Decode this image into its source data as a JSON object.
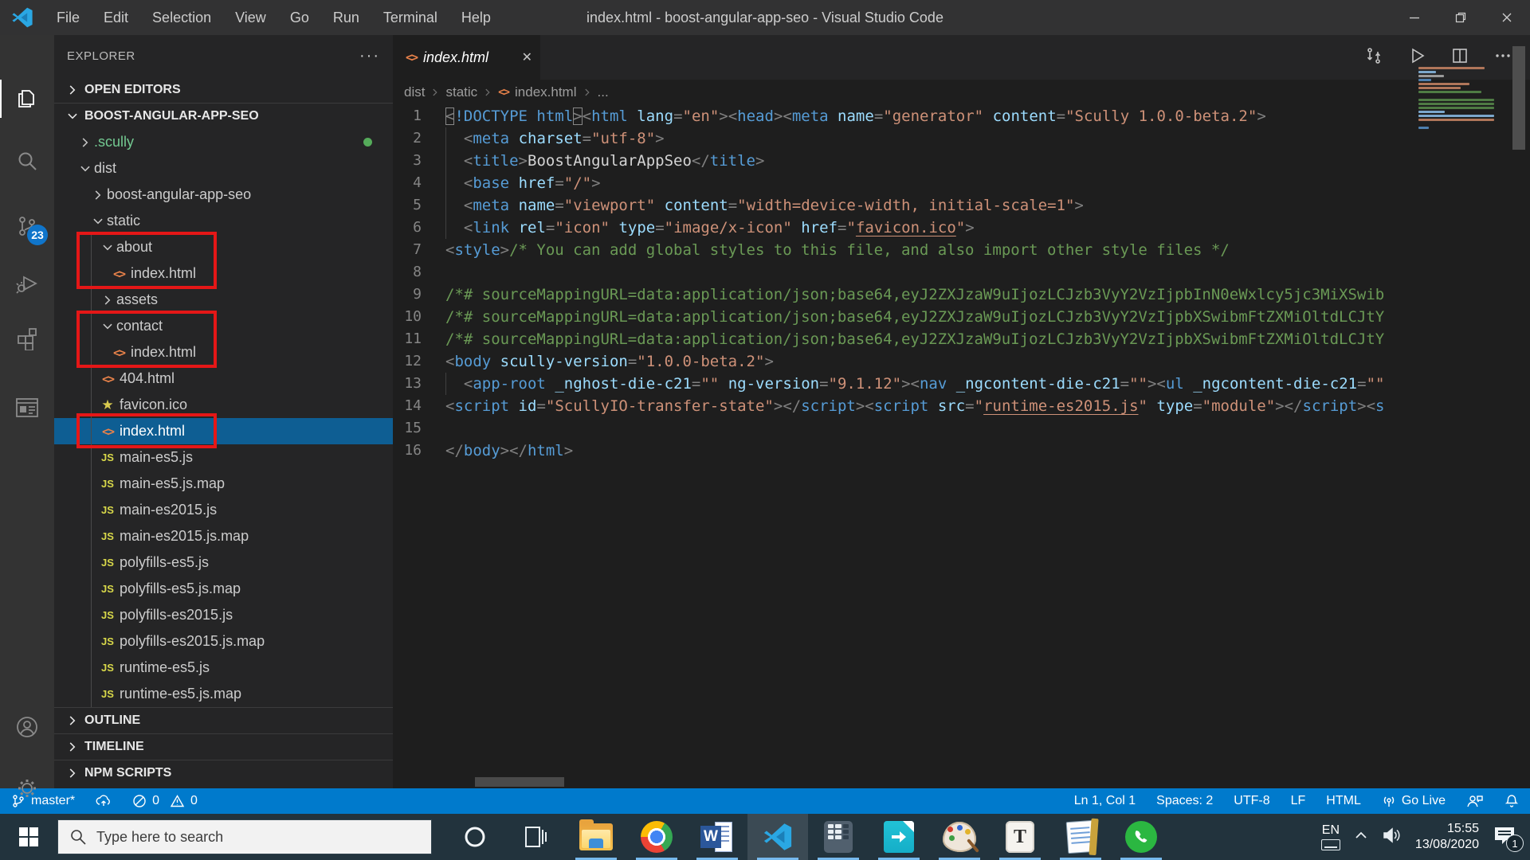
{
  "window": {
    "title": "index.html - boost-angular-app-seo - Visual Studio Code"
  },
  "menu": {
    "items": [
      "File",
      "Edit",
      "Selection",
      "View",
      "Go",
      "Run",
      "Terminal",
      "Help"
    ]
  },
  "activity_bar": {
    "source_control_badge": "23"
  },
  "explorer": {
    "title": "EXPLORER",
    "open_editors": "OPEN EDITORS",
    "project": "BOOST-ANGULAR-APP-SEO",
    "tree": [
      {
        "label": ".scully",
        "kind": "folder",
        "expanded": false,
        "level": 1,
        "green": true,
        "dot": true
      },
      {
        "label": "dist",
        "kind": "folder",
        "expanded": true,
        "level": 1
      },
      {
        "label": "boost-angular-app-seo",
        "kind": "folder",
        "expanded": false,
        "level": 2
      },
      {
        "label": "static",
        "kind": "folder",
        "expanded": true,
        "level": 2
      },
      {
        "label": "about",
        "kind": "folder",
        "expanded": true,
        "level": 3
      },
      {
        "label": "index.html",
        "kind": "html",
        "level": 4
      },
      {
        "label": "assets",
        "kind": "folder",
        "expanded": false,
        "level": 3
      },
      {
        "label": "contact",
        "kind": "folder",
        "expanded": true,
        "level": 3
      },
      {
        "label": "index.html",
        "kind": "html",
        "level": 4
      },
      {
        "label": "404.html",
        "kind": "html",
        "level": 3
      },
      {
        "label": "favicon.ico",
        "kind": "ico",
        "level": 3
      },
      {
        "label": "index.html",
        "kind": "html",
        "level": 3,
        "selected": true
      },
      {
        "label": "main-es5.js",
        "kind": "js",
        "level": 3
      },
      {
        "label": "main-es5.js.map",
        "kind": "js",
        "level": 3
      },
      {
        "label": "main-es2015.js",
        "kind": "js",
        "level": 3
      },
      {
        "label": "main-es2015.js.map",
        "kind": "js",
        "level": 3
      },
      {
        "label": "polyfills-es5.js",
        "kind": "js",
        "level": 3
      },
      {
        "label": "polyfills-es5.js.map",
        "kind": "js",
        "level": 3
      },
      {
        "label": "polyfills-es2015.js",
        "kind": "js",
        "level": 3
      },
      {
        "label": "polyfills-es2015.js.map",
        "kind": "js",
        "level": 3
      },
      {
        "label": "runtime-es5.js",
        "kind": "js",
        "level": 3
      },
      {
        "label": "runtime-es5.js.map",
        "kind": "js",
        "level": 3
      }
    ],
    "sections": [
      "OUTLINE",
      "TIMELINE",
      "NPM SCRIPTS"
    ]
  },
  "editor": {
    "tab": {
      "label": "index.html"
    },
    "breadcrumb": [
      "dist",
      "static",
      "index.html",
      "..."
    ],
    "lines": [
      {
        "seg": [
          [
            "b",
            "<"
          ],
          [
            "t",
            "!DOCTYPE html"
          ],
          [
            "b",
            ">"
          ],
          [
            "p",
            "<"
          ],
          [
            "t",
            "html"
          ],
          [
            "x",
            " "
          ],
          [
            "a",
            "lang"
          ],
          [
            "p",
            "="
          ],
          [
            "v",
            "\"en\""
          ],
          [
            "p",
            "><"
          ],
          [
            "t",
            "head"
          ],
          [
            "p",
            "><"
          ],
          [
            "t",
            "meta"
          ],
          [
            "x",
            " "
          ],
          [
            "a",
            "name"
          ],
          [
            "p",
            "="
          ],
          [
            "v",
            "\"generator\""
          ],
          [
            "x",
            " "
          ],
          [
            "a",
            "content"
          ],
          [
            "p",
            "="
          ],
          [
            "v",
            "\"Scully 1.0.0-beta.2\""
          ],
          [
            "p",
            ">"
          ]
        ]
      },
      {
        "guide": true,
        "seg": [
          [
            "x",
            "  "
          ],
          [
            "p",
            "<"
          ],
          [
            "t",
            "meta"
          ],
          [
            "x",
            " "
          ],
          [
            "a",
            "charset"
          ],
          [
            "p",
            "="
          ],
          [
            "v",
            "\"utf-8\""
          ],
          [
            "p",
            ">"
          ]
        ]
      },
      {
        "guide": true,
        "seg": [
          [
            "x",
            "  "
          ],
          [
            "p",
            "<"
          ],
          [
            "t",
            "title"
          ],
          [
            "p",
            ">"
          ],
          [
            "x",
            "BoostAngularAppSeo"
          ],
          [
            "p",
            "</"
          ],
          [
            "t",
            "title"
          ],
          [
            "p",
            ">"
          ]
        ]
      },
      {
        "guide": true,
        "seg": [
          [
            "x",
            "  "
          ],
          [
            "p",
            "<"
          ],
          [
            "t",
            "base"
          ],
          [
            "x",
            " "
          ],
          [
            "a",
            "href"
          ],
          [
            "p",
            "="
          ],
          [
            "v",
            "\"/\""
          ],
          [
            "p",
            ">"
          ]
        ]
      },
      {
        "guide": true,
        "seg": [
          [
            "x",
            "  "
          ],
          [
            "p",
            "<"
          ],
          [
            "t",
            "meta"
          ],
          [
            "x",
            " "
          ],
          [
            "a",
            "name"
          ],
          [
            "p",
            "="
          ],
          [
            "v",
            "\"viewport\""
          ],
          [
            "x",
            " "
          ],
          [
            "a",
            "content"
          ],
          [
            "p",
            "="
          ],
          [
            "v",
            "\"width=device-width, initial-scale=1\""
          ],
          [
            "p",
            ">"
          ]
        ]
      },
      {
        "guide": true,
        "seg": [
          [
            "x",
            "  "
          ],
          [
            "p",
            "<"
          ],
          [
            "t",
            "link"
          ],
          [
            "x",
            " "
          ],
          [
            "a",
            "rel"
          ],
          [
            "p",
            "="
          ],
          [
            "v",
            "\"icon\""
          ],
          [
            "x",
            " "
          ],
          [
            "a",
            "type"
          ],
          [
            "p",
            "="
          ],
          [
            "v",
            "\"image/x-icon\""
          ],
          [
            "x",
            " "
          ],
          [
            "a",
            "href"
          ],
          [
            "p",
            "="
          ],
          [
            "v",
            "\""
          ],
          [
            "u",
            "favicon.ico"
          ],
          [
            "v",
            "\""
          ],
          [
            "p",
            ">"
          ]
        ]
      },
      {
        "seg": [
          [
            "p",
            "<"
          ],
          [
            "t",
            "style"
          ],
          [
            "p",
            ">"
          ],
          [
            "c",
            "/* You can add global styles to this file, and also import other style files */"
          ]
        ]
      },
      {
        "seg": []
      },
      {
        "seg": [
          [
            "c",
            "/*# sourceMappingURL=data:application/json;base64,eyJ2ZXJzaW9uIjozLCJzb3VyY2VzIjpbInN0eWxlcy5jc3MiXSwib"
          ]
        ]
      },
      {
        "seg": [
          [
            "c",
            "/*# sourceMappingURL=data:application/json;base64,eyJ2ZXJzaW9uIjozLCJzb3VyY2VzIjpbXSwibmFtZXMiOltdLCJtY"
          ]
        ]
      },
      {
        "seg": [
          [
            "c",
            "/*# sourceMappingURL=data:application/json;base64,eyJ2ZXJzaW9uIjozLCJzb3VyY2VzIjpbXSwibmFtZXMiOltdLCJtY"
          ]
        ]
      },
      {
        "seg": [
          [
            "p",
            "<"
          ],
          [
            "t",
            "body"
          ],
          [
            "x",
            " "
          ],
          [
            "a",
            "scully-version"
          ],
          [
            "p",
            "="
          ],
          [
            "v",
            "\"1.0.0-beta.2\""
          ],
          [
            "p",
            ">"
          ]
        ]
      },
      {
        "guide": true,
        "seg": [
          [
            "x",
            "  "
          ],
          [
            "p",
            "<"
          ],
          [
            "t",
            "app-root"
          ],
          [
            "x",
            " "
          ],
          [
            "a",
            "_nghost-die-c21"
          ],
          [
            "p",
            "="
          ],
          [
            "v",
            "\"\""
          ],
          [
            "x",
            " "
          ],
          [
            "a",
            "ng-version"
          ],
          [
            "p",
            "="
          ],
          [
            "v",
            "\"9.1.12\""
          ],
          [
            "p",
            "><"
          ],
          [
            "t",
            "nav"
          ],
          [
            "x",
            " "
          ],
          [
            "a",
            "_ngcontent-die-c21"
          ],
          [
            "p",
            "="
          ],
          [
            "v",
            "\"\""
          ],
          [
            "p",
            "><"
          ],
          [
            "t",
            "ul"
          ],
          [
            "x",
            " "
          ],
          [
            "a",
            "_ngcontent-die-c21"
          ],
          [
            "p",
            "="
          ],
          [
            "v",
            "\"\""
          ]
        ]
      },
      {
        "seg": [
          [
            "p",
            "<"
          ],
          [
            "t",
            "script"
          ],
          [
            "x",
            " "
          ],
          [
            "a",
            "id"
          ],
          [
            "p",
            "="
          ],
          [
            "v",
            "\"ScullyIO-transfer-state\""
          ],
          [
            "p",
            "></"
          ],
          [
            "t",
            "script"
          ],
          [
            "p",
            "><"
          ],
          [
            "t",
            "script"
          ],
          [
            "x",
            " "
          ],
          [
            "a",
            "src"
          ],
          [
            "p",
            "="
          ],
          [
            "v",
            "\""
          ],
          [
            "u",
            "runtime-es2015.js"
          ],
          [
            "v",
            "\""
          ],
          [
            "x",
            " "
          ],
          [
            "a",
            "type"
          ],
          [
            "p",
            "="
          ],
          [
            "v",
            "\"module\""
          ],
          [
            "p",
            "></"
          ],
          [
            "t",
            "script"
          ],
          [
            "p",
            "><"
          ],
          [
            "t",
            "s"
          ]
        ]
      },
      {
        "seg": []
      },
      {
        "seg": [
          [
            "p",
            "</"
          ],
          [
            "t",
            "body"
          ],
          [
            "p",
            "></"
          ],
          [
            "t",
            "html"
          ],
          [
            "p",
            ">"
          ]
        ]
      }
    ]
  },
  "status_bar": {
    "branch": "master*",
    "errors": "0",
    "warnings": "0",
    "line_col": "Ln 1, Col 1",
    "spaces": "Spaces: 2",
    "encoding": "UTF-8",
    "eol": "LF",
    "language": "HTML",
    "go_live": "Go Live"
  },
  "taskbar": {
    "search_placeholder": "Type here to search",
    "apps": [
      {
        "id": "cortana",
        "running": false
      },
      {
        "id": "task-view",
        "running": false
      },
      {
        "id": "file-explorer",
        "running": true
      },
      {
        "id": "chrome",
        "running": true
      },
      {
        "id": "word",
        "running": true
      },
      {
        "id": "vscode",
        "running": true,
        "active": true
      },
      {
        "id": "calculator",
        "running": true
      },
      {
        "id": "share-app",
        "running": true
      },
      {
        "id": "paint",
        "running": true
      },
      {
        "id": "textpad",
        "running": true
      },
      {
        "id": "notepad",
        "running": true
      },
      {
        "id": "whatsapp",
        "running": true
      }
    ],
    "tray": {
      "lang": "EN",
      "time": "15:55",
      "date": "13/08/2020",
      "notification_badge": "1"
    }
  }
}
